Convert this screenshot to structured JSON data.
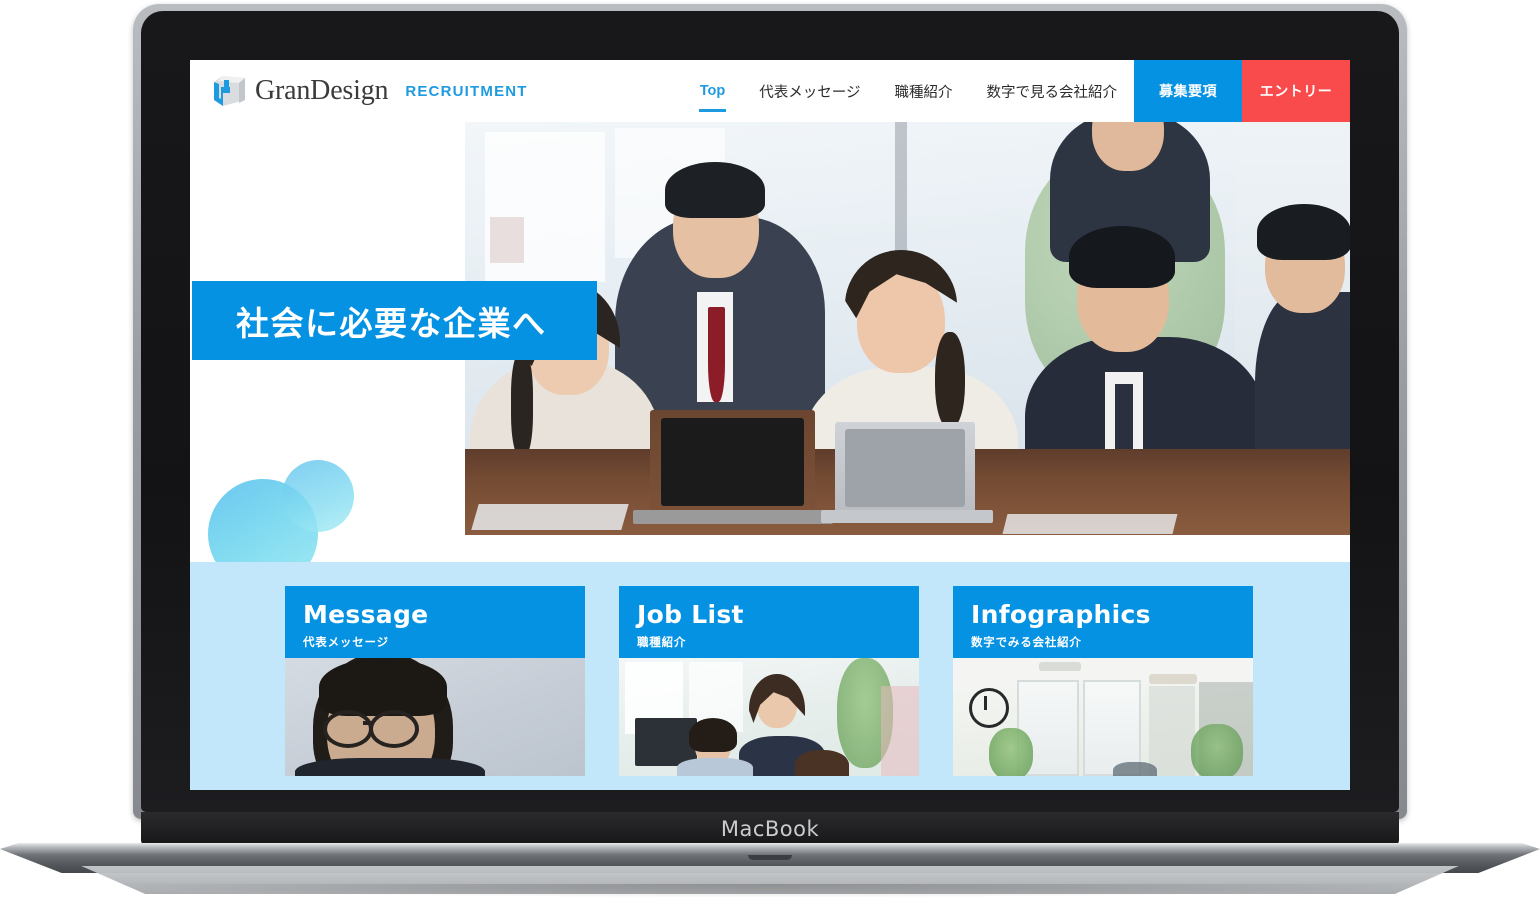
{
  "device": {
    "label": "MacBook",
    "name": "macbook-mockup"
  },
  "site": {
    "header": {
      "logo_icon": "grandesign-cube-logo-icon",
      "brand_name": "GranDesign",
      "brand_subtitle": "RECRUITMENT",
      "nav": [
        {
          "label": "Top",
          "active": true
        },
        {
          "label": "代表メッセージ",
          "active": false
        },
        {
          "label": "職種紹介",
          "active": false
        },
        {
          "label": "数字で見る会社紹介",
          "active": false
        }
      ],
      "cta_primary": "募集要項",
      "cta_secondary": "エントリー"
    },
    "hero": {
      "headline": "社会に必要な企業へ",
      "photo_alt": "会議室でノートパソコンを囲んで話し合うビジネスパーソン5人",
      "decor": "blue-gradient-bubbles"
    },
    "cards": [
      {
        "title": "Message",
        "subtitle": "代表メッセージ",
        "photo_alt": "眼鏡をかけた年配の男性のポートレート"
      },
      {
        "title": "Job List",
        "subtitle": "職種紹介",
        "photo_alt": "明るいオフィスで会話する社員たち"
      },
      {
        "title": "Infographics",
        "subtitle": "数字でみる会社紹介",
        "photo_alt": "窓の多い明るいオフィスの内観"
      }
    ]
  },
  "colors": {
    "brand_blue": "#0692E3",
    "accent_blue": "#1E9BE0",
    "entry_red": "#F94B4B",
    "section_bg": "#C2E7FB",
    "text_dark": "#2b2b2b"
  }
}
